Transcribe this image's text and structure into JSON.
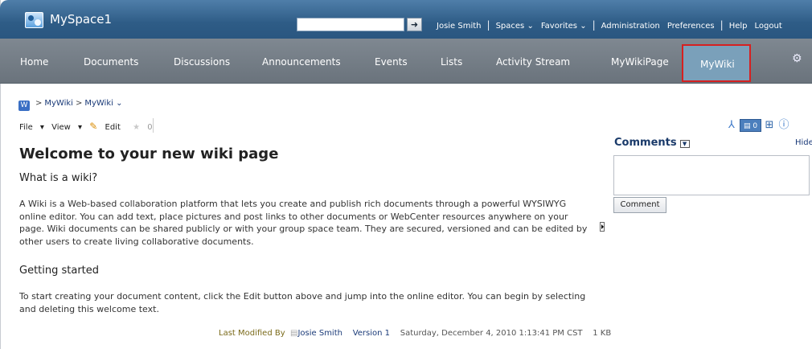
{
  "header": {
    "site_title": "MySpace1",
    "search_value": "",
    "search_go_icon": "arrow-right-icon",
    "user_name": "Josie Smith",
    "spaces_label": "Spaces",
    "favorites_label": "Favorites",
    "administration_label": "Administration",
    "preferences_label": "Preferences",
    "help_label": "Help",
    "logout_label": "Logout"
  },
  "nav": {
    "tabs": [
      "Home",
      "Documents",
      "Discussions",
      "Announcements",
      "Events",
      "Lists",
      "Activity Stream",
      "MyWikiPage",
      "MyWiki"
    ],
    "active_tab": "MyWiki",
    "active_color": "#7aa0ba",
    "highlight_color": "#d62020"
  },
  "breadcrumb": {
    "icon": "W",
    "items": [
      "MyWiki",
      "MyWiki"
    ]
  },
  "toolbar": {
    "file_label": "File",
    "view_label": "View",
    "edit_label": "Edit",
    "rating_count": "0"
  },
  "page": {
    "title": "Welcome to your new wiki page",
    "section1_heading": "What is a wiki?",
    "section1_text": "A Wiki is a Web-based collaboration platform that lets you create and publish rich documents through a powerful WYSIWYG online editor. You can add text, place pictures and post links to other documents or WebCenter resources anywhere on your page. Wiki documents can be shared publicly or with your group space team. They are secured, versioned and can be edited by other users to create living collaborative documents.",
    "section2_heading": "Getting started",
    "section2_text": "To start creating your document content, click the Edit button above and jump into the online editor. You can begin by selecting and deleting this welcome text."
  },
  "footer": {
    "last_modified_label": "Last Modified By",
    "author": "Josie Smith",
    "version": "Version 1",
    "timestamp": "Saturday, December 4, 2010 1:13:41 PM CST",
    "size": "1 KB"
  },
  "comments": {
    "title": "Comments",
    "hide_label": "Hide",
    "count": "0",
    "button_label": "Comment"
  }
}
